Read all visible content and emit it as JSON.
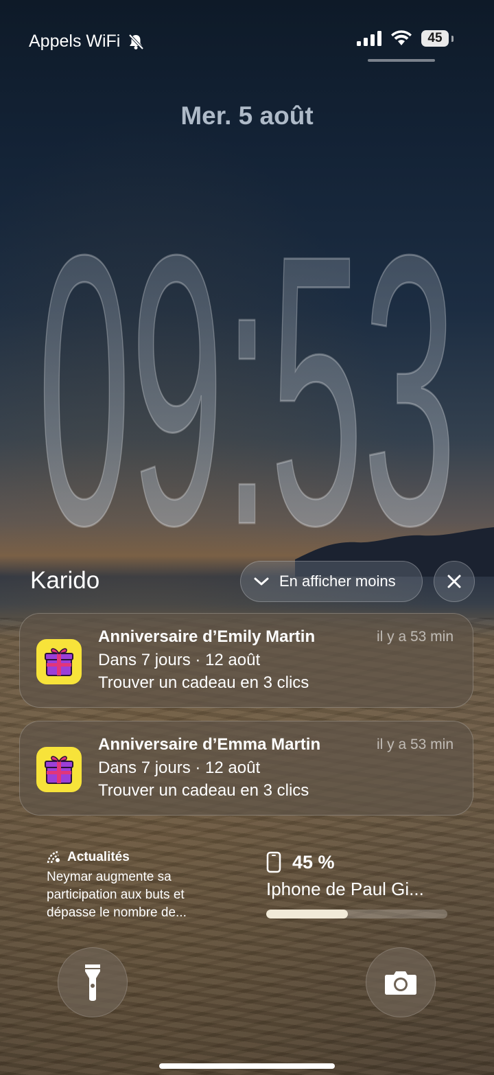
{
  "status_bar": {
    "carrier": "Appels WiFi",
    "silent_icon": "bell-slash-icon",
    "signal_icon": "signal-bars-icon",
    "wifi_icon": "wifi-icon",
    "battery_level": "45"
  },
  "lock_screen": {
    "date": "Mer. 5 août",
    "time": "09:53"
  },
  "notification_group": {
    "app_name": "Karido",
    "show_less_label": "En afficher moins",
    "close_icon": "close-icon",
    "notifications": [
      {
        "icon": "gift-icon",
        "title": "Anniversaire d’Emily Martin",
        "time": "il y a 53 min",
        "line1": "Dans 7 jours · 12 août",
        "line2": "Trouver un cadeau en 3 clics"
      },
      {
        "icon": "gift-icon",
        "title": "Anniversaire d’Emma Martin",
        "time": "il y a 53 min",
        "line1": "Dans 7 jours · 12 août",
        "line2": "Trouver un cadeau en 3 clics"
      }
    ]
  },
  "widgets": {
    "news": {
      "icon": "news-icon",
      "title": "Actualités",
      "body": "Neymar augmente sa participation aux buts et dépasse le nombre de..."
    },
    "battery": {
      "icon": "phone-icon",
      "percent_label": "45 %",
      "device_name": "Iphone de Paul Gi...",
      "level": 0.45
    }
  },
  "controls": {
    "flashlight_icon": "flashlight-icon",
    "camera_icon": "camera-icon"
  },
  "colors": {
    "gift_bg": "#f7e33a",
    "gift_box": "#9b3fd8",
    "gift_ribbon": "#e2357a"
  }
}
